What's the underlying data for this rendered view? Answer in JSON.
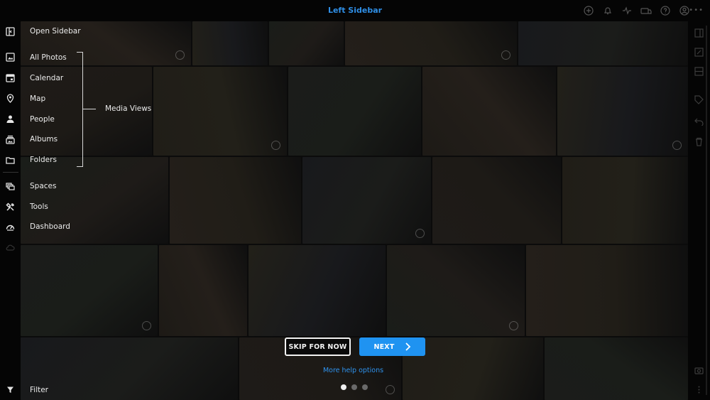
{
  "header": {
    "title": "Left Sidebar"
  },
  "sidebar": {
    "open_label": "Open Sidebar",
    "items": [
      {
        "label": "All Photos",
        "icon": "photo-icon"
      },
      {
        "label": "Calendar",
        "icon": "calendar-icon"
      },
      {
        "label": "Map",
        "icon": "map-pin-icon"
      },
      {
        "label": "People",
        "icon": "person-icon"
      },
      {
        "label": "Albums",
        "icon": "albums-icon"
      },
      {
        "label": "Folders",
        "icon": "folder-icon"
      },
      {
        "label": "Spaces",
        "icon": "spaces-icon"
      },
      {
        "label": "Tools",
        "icon": "tools-icon"
      },
      {
        "label": "Dashboard",
        "icon": "dashboard-icon"
      }
    ],
    "group_label": "Media Views",
    "filter_label": "Filter"
  },
  "onboarding": {
    "skip_label": "SKIP FOR NOW",
    "next_label": "NEXT",
    "help_link": "More help options",
    "page_count": 3,
    "current_page": 1
  },
  "colors": {
    "accent": "#1f93f1",
    "title": "#2f8fe6",
    "background": "#0b0b0b"
  }
}
